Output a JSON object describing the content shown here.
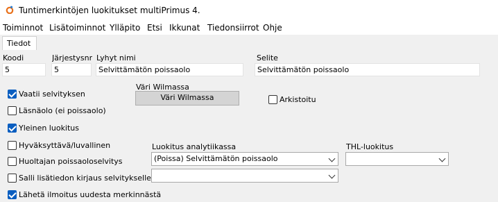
{
  "window": {
    "title": "Tuntimerkintöjen luokitukset multiPrimus 4."
  },
  "menu": [
    "Toiminnot",
    "Lisätoiminnot",
    "Ylläpito",
    "Etsi",
    "Ikkunat",
    "Tiedonsiirrot",
    "Ohje"
  ],
  "tabs": [
    "Tiedot"
  ],
  "fields": {
    "koodi": {
      "label": "Koodi",
      "value": "5"
    },
    "jarjestys": {
      "label": "Järjestysnro",
      "value": "5"
    },
    "lyhyt_nimi": {
      "label": "Lyhyt nimi",
      "value": "Selvittämätön poissaolo"
    },
    "selite": {
      "label": "Selite",
      "value": "Selvittämätön poissaolo"
    }
  },
  "checkboxes": [
    {
      "label": "Vaatii selvityksen",
      "checked": true
    },
    {
      "label": "Läsnäolo (ei poissaolo)",
      "checked": false
    },
    {
      "label": "Yleinen luokitus",
      "checked": true
    },
    {
      "label": "Hyväksyttävä/luvallinen",
      "checked": false
    },
    {
      "label": "Huoltajan poissaoloselvitys",
      "checked": false
    },
    {
      "label": "Salli lisätiedon kirjaus selvitykselle",
      "checked": false
    },
    {
      "label": "Lähetä ilmoitus uudesta merkinnästä",
      "checked": true
    }
  ],
  "wilma": {
    "label": "Väri Wilmassa",
    "button": "Väri Wilmassa"
  },
  "arkistoitu": {
    "label": "Arkistoitu",
    "checked": false
  },
  "analytiikka": {
    "label": "Luokitus analytiikassa",
    "value": "(Poissa) Selvittämätön poissaolo",
    "second_value": ""
  },
  "thl": {
    "label": "THL-luokitus",
    "value": ""
  },
  "colors": {
    "checkbox_accent": "#0a5ec0",
    "button_bg": "#d4d4d4",
    "icon_orange": "#e8711b"
  }
}
